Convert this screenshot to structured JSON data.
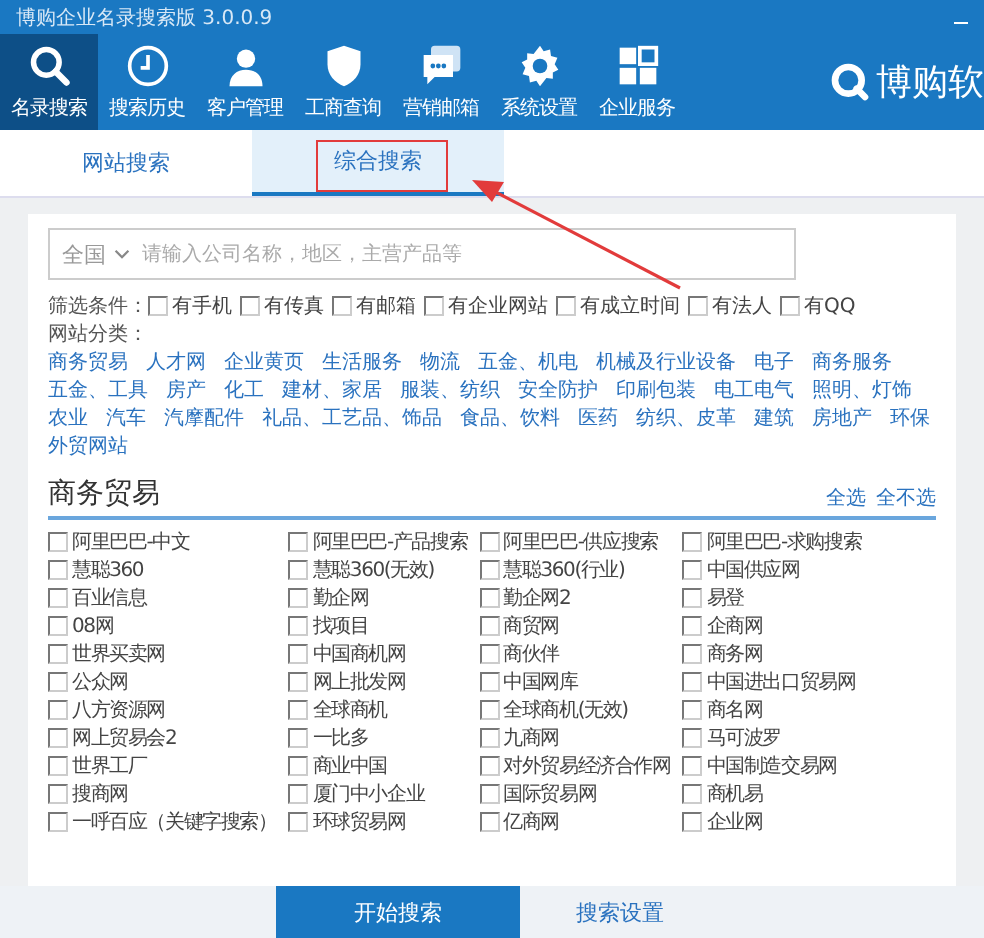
{
  "window": {
    "title": "博购企业名录搜索版 3.0.0.9"
  },
  "nav": [
    {
      "label": "名录搜索",
      "selected": true
    },
    {
      "label": "搜索历史",
      "selected": false
    },
    {
      "label": "客户管理",
      "selected": false
    },
    {
      "label": "工商查询",
      "selected": false
    },
    {
      "label": "营销邮箱",
      "selected": false
    },
    {
      "label": "系统设置",
      "selected": false
    },
    {
      "label": "企业服务",
      "selected": false
    }
  ],
  "logo": "博购软",
  "tabs": [
    {
      "label": "网站搜索",
      "selected": false
    },
    {
      "label": "综合搜索",
      "selected": true
    }
  ],
  "search": {
    "region": "全国",
    "placeholder": "请输入公司名称，地区，主营产品等"
  },
  "filters": {
    "label": "筛选条件：",
    "options": [
      {
        "label": "有手机",
        "checked": false
      },
      {
        "label": "有传真",
        "checked": false
      },
      {
        "label": "有邮箱",
        "checked": false
      },
      {
        "label": "有企业网站",
        "checked": false
      },
      {
        "label": "有成立时间",
        "checked": false
      },
      {
        "label": "有法人",
        "checked": false
      },
      {
        "label": "有QQ",
        "checked": false
      }
    ]
  },
  "categories": {
    "label": "网站分类：",
    "items": [
      "商务贸易",
      "人才网",
      "企业黄页",
      "生活服务",
      "物流",
      "五金、机电",
      "机械及行业设备",
      "电子",
      "商务服务",
      "五金、工具",
      "房产",
      "化工",
      "建材、家居",
      "服装、纺织",
      "安全防护",
      "印刷包装",
      "电工电气",
      "照明、灯饰",
      "农业",
      "汽车",
      "汽摩配件",
      "礼品、工艺品、饰品",
      "食品、饮料",
      "医药",
      "纺织、皮革",
      "建筑",
      "房地产",
      "环保",
      "外贸网站"
    ]
  },
  "section": {
    "title": "商务贸易",
    "select_all": "全选",
    "select_none": "全不选"
  },
  "sites": [
    {
      "label": "阿里巴巴-中文",
      "checked": false
    },
    {
      "label": "阿里巴巴-产品搜索",
      "checked": false
    },
    {
      "label": "阿里巴巴-供应搜索",
      "checked": false
    },
    {
      "label": "阿里巴巴-求购搜索",
      "checked": false
    },
    {
      "label": "慧聪360",
      "checked": false
    },
    {
      "label": "慧聪360(无效)",
      "checked": false
    },
    {
      "label": "慧聪360(行业)",
      "checked": false
    },
    {
      "label": "中国供应网",
      "checked": false
    },
    {
      "label": "百业信息",
      "checked": false
    },
    {
      "label": "勤企网",
      "checked": false
    },
    {
      "label": "勤企网2",
      "checked": false
    },
    {
      "label": "易登",
      "checked": false
    },
    {
      "label": "08网",
      "checked": false
    },
    {
      "label": "找项目",
      "checked": false
    },
    {
      "label": "商贸网",
      "checked": false
    },
    {
      "label": "企商网",
      "checked": false
    },
    {
      "label": "世界买卖网",
      "checked": false
    },
    {
      "label": "中国商机网",
      "checked": false
    },
    {
      "label": "商伙伴",
      "checked": false
    },
    {
      "label": "商务网",
      "checked": false
    },
    {
      "label": "公众网",
      "checked": false
    },
    {
      "label": "网上批发网",
      "checked": false
    },
    {
      "label": "中国网库",
      "checked": false
    },
    {
      "label": "中国进出口贸易网",
      "checked": false
    },
    {
      "label": "八方资源网",
      "checked": false
    },
    {
      "label": "全球商机",
      "checked": false
    },
    {
      "label": "全球商机(无效)",
      "checked": false
    },
    {
      "label": "商名网",
      "checked": false
    },
    {
      "label": "网上贸易会2",
      "checked": false
    },
    {
      "label": "一比多",
      "checked": false
    },
    {
      "label": "九商网",
      "checked": false
    },
    {
      "label": "马可波罗",
      "checked": false
    },
    {
      "label": "世界工厂",
      "checked": false
    },
    {
      "label": "商业中国",
      "checked": false
    },
    {
      "label": "对外贸易经济合作网",
      "checked": false
    },
    {
      "label": "中国制造交易网",
      "checked": false
    },
    {
      "label": "搜商网",
      "checked": false
    },
    {
      "label": "厦门中小企业",
      "checked": false
    },
    {
      "label": "国际贸易网",
      "checked": false
    },
    {
      "label": "商机易",
      "checked": false
    },
    {
      "label": "一呼百应（关键字搜索）",
      "checked": false
    },
    {
      "label": "环球贸易网",
      "checked": false
    },
    {
      "label": "亿商网",
      "checked": false
    },
    {
      "label": "企业网",
      "checked": false
    }
  ],
  "actions": {
    "start": "开始搜索",
    "settings": "搜索设置"
  }
}
